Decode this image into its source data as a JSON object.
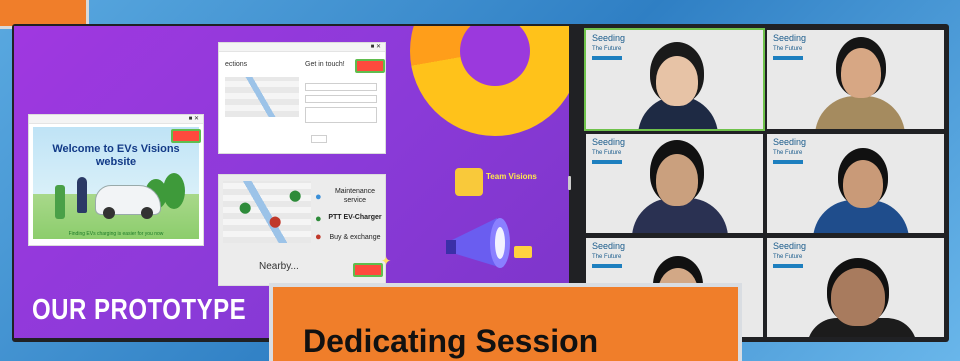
{
  "slide": {
    "title": "OUR PROTOTYPE",
    "welcome_title": "Welcome to EVs Visions website",
    "welcome_footer": "Finding EVs charging is easier for you now",
    "contact_heading": "Get in touch!",
    "directions_label": "ections",
    "nearby_label": "Nearby...",
    "legend": [
      {
        "icon": "map-pin-blue-icon",
        "label": "Maintenance service"
      },
      {
        "icon": "map-pin-green-icon",
        "label": "PTT EV-Charger"
      },
      {
        "icon": "map-pin-red-icon",
        "label": "Buy & exchange"
      }
    ],
    "team_name": "Team Visions"
  },
  "participants": [
    {
      "logo_line1": "Seeding",
      "logo_line2": "The Future"
    },
    {
      "logo_line1": "Seeding",
      "logo_line2": "The Future"
    },
    {
      "logo_line1": "Seeding",
      "logo_line2": "The Future"
    },
    {
      "logo_line1": "Seeding",
      "logo_line2": "The Future"
    },
    {
      "logo_line1": "Seeding",
      "logo_line2": "The Future"
    },
    {
      "logo_line1": "Seeding",
      "logo_line2": "The Future"
    }
  ],
  "banner": {
    "text": "Dedicating Session"
  },
  "colors": {
    "accent_orange": "#f07e2a",
    "slide_purple": "#9b39dd",
    "active_speaker": "#6fc24b"
  }
}
